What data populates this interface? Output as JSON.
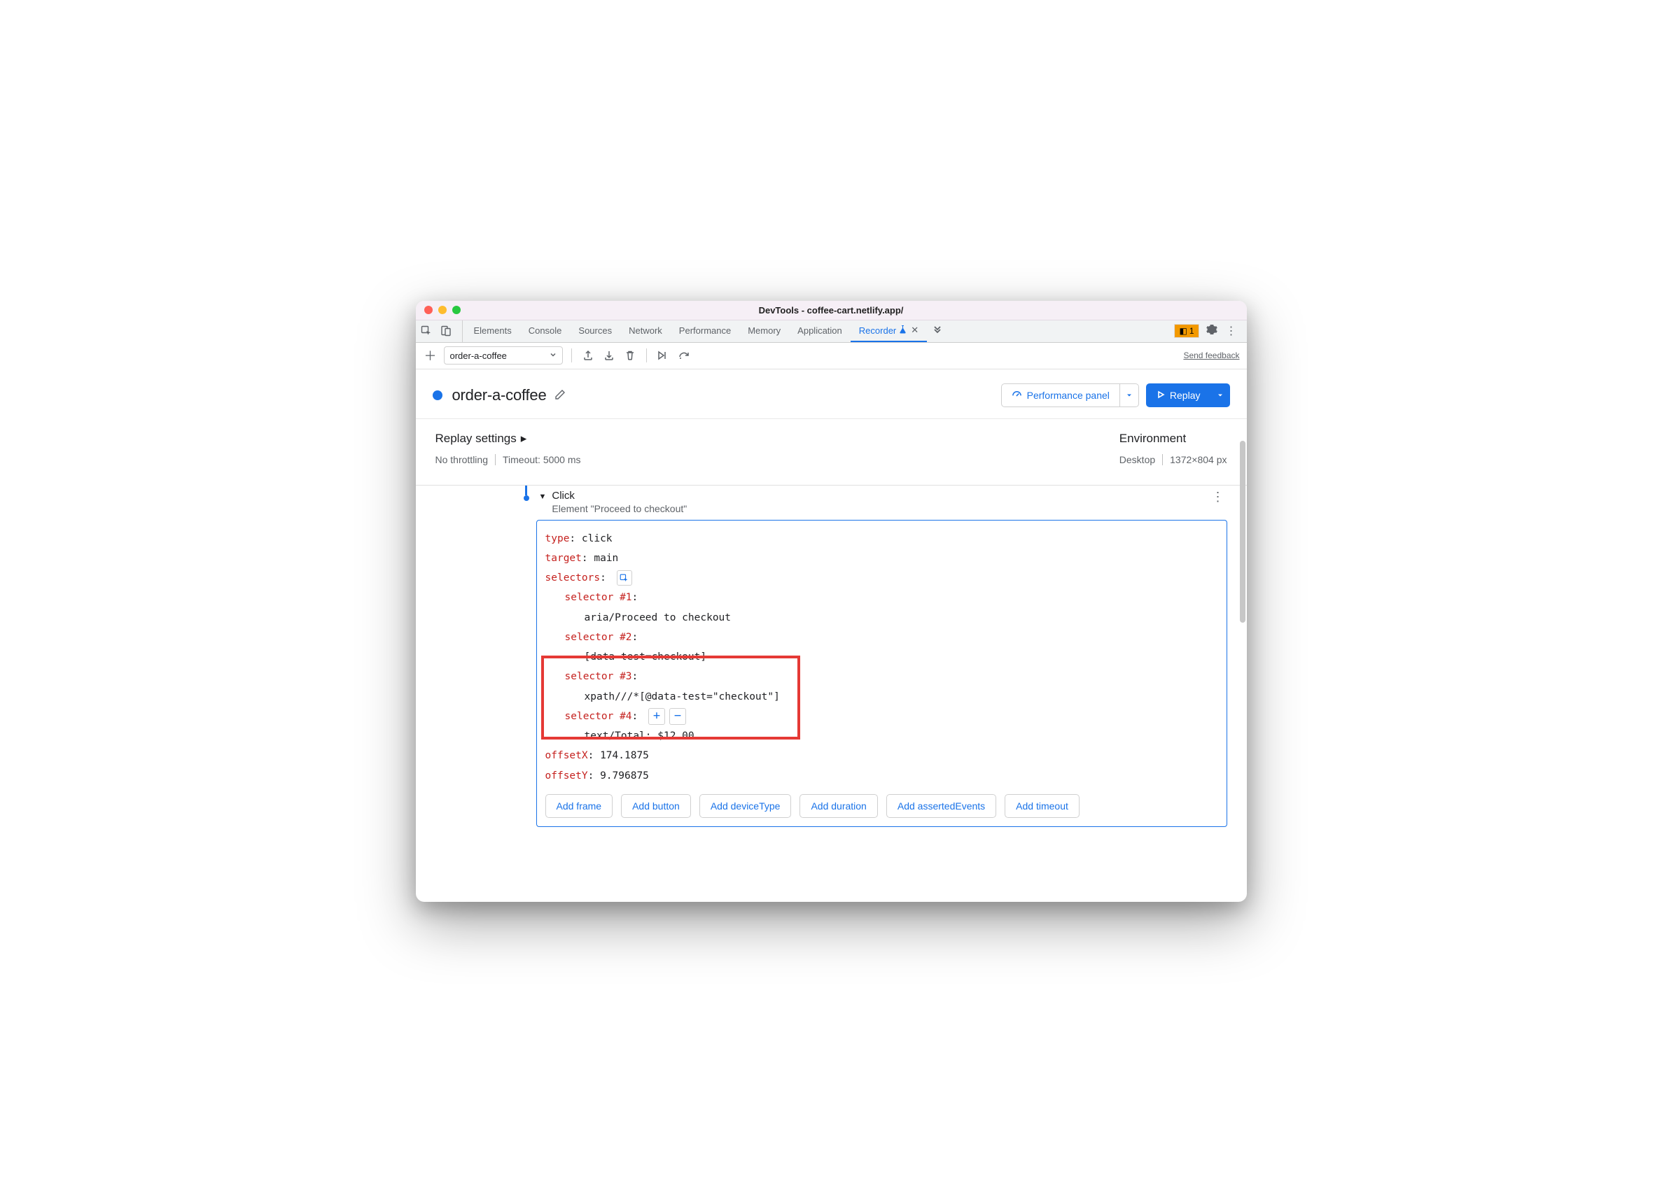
{
  "window": {
    "title": "DevTools - coffee-cart.netlify.app/"
  },
  "tabs": {
    "items": [
      "Elements",
      "Console",
      "Sources",
      "Network",
      "Performance",
      "Memory",
      "Application",
      "Recorder"
    ],
    "active": 7,
    "badge_count": "1"
  },
  "toolbar": {
    "recording_name": "order-a-coffee",
    "feedback": "Send feedback"
  },
  "header": {
    "title": "order-a-coffee",
    "perf_button": "Performance panel",
    "replay_button": "Replay"
  },
  "settings": {
    "replay_heading": "Replay settings",
    "throttle": "No throttling",
    "timeout": "Timeout: 5000 ms",
    "env_heading": "Environment",
    "device": "Desktop",
    "viewport": "1372×804 px"
  },
  "step": {
    "title": "Click",
    "subtitle": "Element \"Proceed to checkout\"",
    "type_key": "type",
    "type_val": "click",
    "target_key": "target",
    "target_val": "main",
    "selectors_key": "selectors",
    "sel1_key": "selector #1",
    "sel1_val": "aria/Proceed to checkout",
    "sel2_key": "selector #2",
    "sel2_val": "[data-test=checkout]",
    "sel3_key": "selector #3",
    "sel3_val": "xpath///*[@data-test=\"checkout\"]",
    "sel4_key": "selector #4",
    "sel4_val": "text/Total: $12.00",
    "offsetX_key": "offsetX",
    "offsetX_val": "174.1875",
    "offsetY_key": "offsetY",
    "offsetY_val": "9.796875"
  },
  "add_buttons": [
    "Add frame",
    "Add button",
    "Add deviceType",
    "Add duration",
    "Add assertedEvents",
    "Add timeout"
  ]
}
